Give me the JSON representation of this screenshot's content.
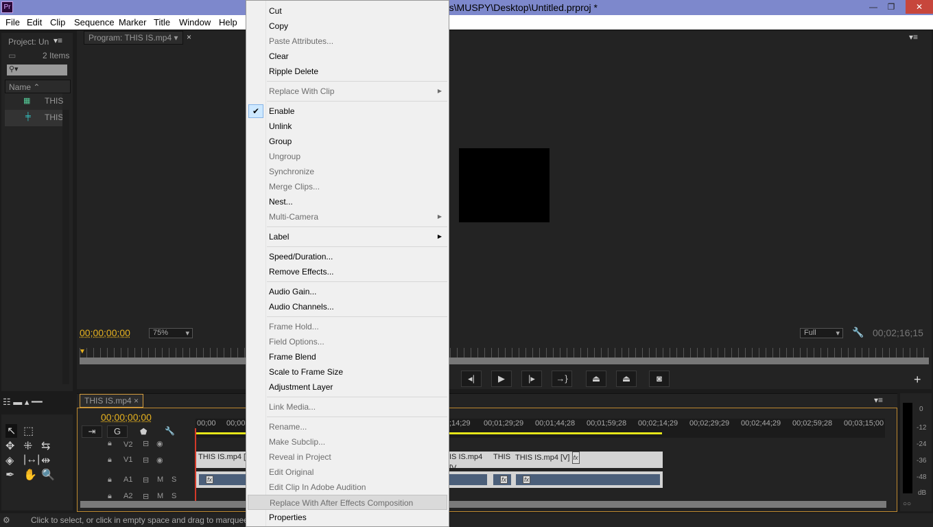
{
  "title_bar": {
    "app_icon": "Pr",
    "title": "rs\\MUSPY\\Desktop\\Untitled.prproj *",
    "controls": [
      "minimize",
      "restore",
      "close"
    ]
  },
  "menu_bar": [
    "File",
    "Edit",
    "Clip",
    "Sequence",
    "Marker",
    "Title",
    "Window",
    "Help"
  ],
  "project_panel": {
    "tab": "Project: Un",
    "item_count": "2 Items",
    "search_placeholder": "",
    "column_header": "Name",
    "items": [
      "THIS",
      "THIS"
    ]
  },
  "program_monitor": {
    "tab": "Program: THIS IS.mp4",
    "timecode_current": "00;00;00;00",
    "zoom": "75%",
    "quality": "Full",
    "timecode_duration": "00;02;16;15"
  },
  "timeline": {
    "tab": "THIS IS.mp4",
    "timecode": "00;00;00;00",
    "ruler": [
      "00;00",
      "00;00",
      ";14;29",
      "00;01;29;29",
      "00;01;44;28",
      "00;01;59;28",
      "00;02;14;29",
      "00;02;29;29",
      "00;02;44;29",
      "00;02;59;28",
      "00;03;15;00"
    ],
    "tracks": [
      {
        "name": "V2",
        "type": "video"
      },
      {
        "name": "V1",
        "type": "video"
      },
      {
        "name": "A1",
        "type": "audio",
        "m": "M",
        "s": "S"
      },
      {
        "name": "A2",
        "type": "audio",
        "m": "M",
        "s": "S"
      }
    ],
    "clips_v1": [
      "THIS IS.mp4 [",
      "IS IS.mp4 [V",
      "THIS",
      "THIS IS.mp4 [V]"
    ],
    "fx_label": "fx"
  },
  "audio_meter": {
    "labels": [
      "0",
      "-12",
      "-24",
      "-36",
      "-48",
      "dB"
    ],
    "solo": "○○"
  },
  "status_bar": "Click to select, or click in empty space and drag to marquee s",
  "context_menu": {
    "items": [
      {
        "label": "Cut",
        "enabled": true
      },
      {
        "label": "Copy",
        "enabled": true
      },
      {
        "label": "Paste Attributes...",
        "enabled": false
      },
      {
        "label": "Clear",
        "enabled": true
      },
      {
        "label": "Ripple Delete",
        "enabled": true
      },
      {
        "separator": true
      },
      {
        "label": "Replace With Clip",
        "enabled": false,
        "submenu": true
      },
      {
        "separator": true
      },
      {
        "label": "Enable",
        "enabled": true,
        "checked": true
      },
      {
        "label": "Unlink",
        "enabled": true
      },
      {
        "label": "Group",
        "enabled": true
      },
      {
        "label": "Ungroup",
        "enabled": false
      },
      {
        "label": "Synchronize",
        "enabled": false
      },
      {
        "label": "Merge Clips...",
        "enabled": false
      },
      {
        "label": "Nest...",
        "enabled": true
      },
      {
        "label": "Multi-Camera",
        "enabled": false,
        "submenu": true
      },
      {
        "separator": true
      },
      {
        "label": "Label",
        "enabled": true,
        "submenu": true
      },
      {
        "separator": true
      },
      {
        "label": "Speed/Duration...",
        "enabled": true
      },
      {
        "label": "Remove Effects...",
        "enabled": true
      },
      {
        "separator": true
      },
      {
        "label": "Audio Gain...",
        "enabled": true
      },
      {
        "label": "Audio Channels...",
        "enabled": true
      },
      {
        "separator": true
      },
      {
        "label": "Frame Hold...",
        "enabled": false
      },
      {
        "label": "Field Options...",
        "enabled": false
      },
      {
        "label": "Frame Blend",
        "enabled": true
      },
      {
        "label": "Scale to Frame Size",
        "enabled": true
      },
      {
        "label": "Adjustment Layer",
        "enabled": true
      },
      {
        "separator": true
      },
      {
        "label": "Link Media...",
        "enabled": false
      },
      {
        "separator": true
      },
      {
        "label": "Rename...",
        "enabled": false
      },
      {
        "label": "Make Subclip...",
        "enabled": false
      },
      {
        "label": "Reveal in Project",
        "enabled": false
      },
      {
        "label": "Edit Original",
        "enabled": false
      },
      {
        "label": "Edit Clip In Adobe Audition",
        "enabled": false
      },
      {
        "label": "Replace With After Effects Composition",
        "enabled": false,
        "highlighted": true
      },
      {
        "label": "Properties",
        "enabled": true
      }
    ]
  },
  "colors": {
    "timecode": "#e7b21f",
    "title_bar": "#7d88cc",
    "close": "#c7463c",
    "panel": "#232323",
    "audio_clip": "#4b5f7a"
  }
}
